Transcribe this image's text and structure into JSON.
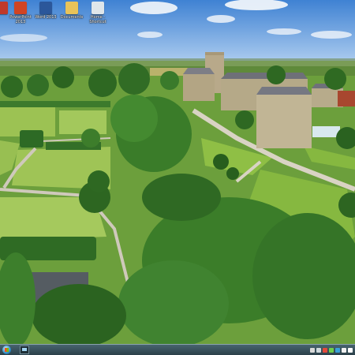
{
  "desktop": {
    "icons": [
      {
        "label": "",
        "icon": "pdf-document-icon",
        "color": "#c0392b"
      },
      {
        "label": "PowerPoint 2013",
        "icon": "powerpoint-icon",
        "color": "#d04423"
      },
      {
        "label": "Word 2013",
        "icon": "word-icon",
        "color": "#2b579a"
      },
      {
        "label": "Documents",
        "icon": "documents-folder-icon",
        "color": "#e8c35a"
      },
      {
        "label": "Home - Shortcut",
        "icon": "shortcut-icon",
        "color": "#dfe6ea"
      }
    ]
  },
  "wallpaper": {
    "scene": "aerial-estate-photo",
    "colors": {
      "sky": "#4f8fd8",
      "lawn": "#8cbf4a",
      "trees": "#2f6d24",
      "stone": "#b7aa8c"
    }
  },
  "taskbar": {
    "start": "windows-start-orb-icon",
    "pinned": [
      {
        "icon": "monitor-icon"
      }
    ],
    "tray": [
      {
        "icon": "network-icon",
        "color": "#d8d8d8"
      },
      {
        "icon": "volume-icon",
        "color": "#cfd8dc"
      },
      {
        "icon": "flag-icon",
        "color": "#e34a3b"
      },
      {
        "icon": "battery-icon",
        "color": "#6fcf4a"
      },
      {
        "icon": "security-icon",
        "color": "#3aa0d8"
      },
      {
        "icon": "language-icon",
        "color": "#f0f0f0"
      },
      {
        "icon": "clock-icon",
        "color": "#ffffff"
      }
    ],
    "colors": {
      "bar": "#3a525c"
    }
  }
}
